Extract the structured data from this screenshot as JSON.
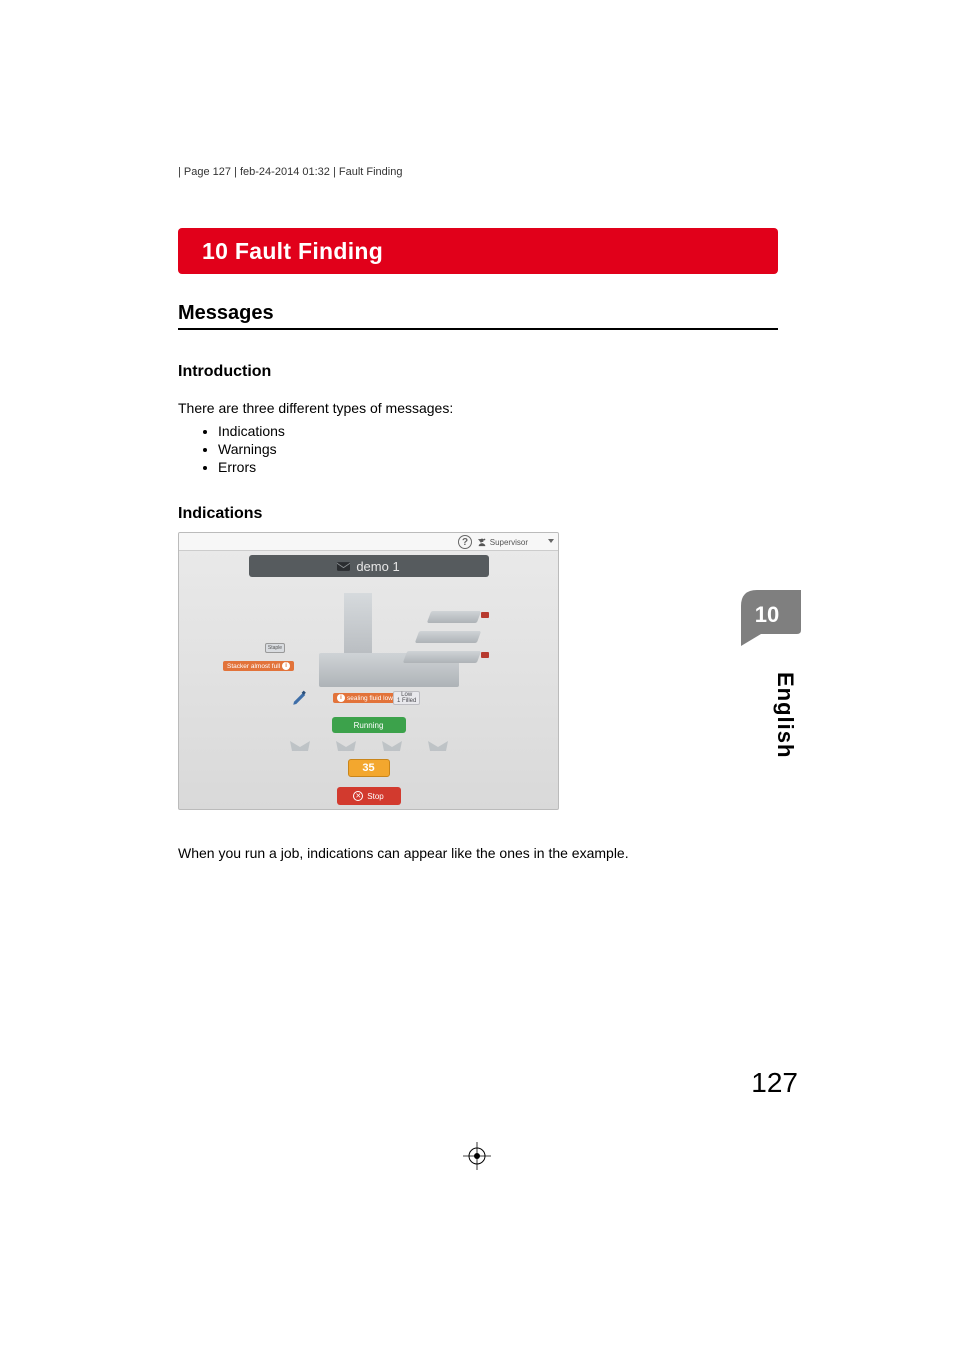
{
  "meta": {
    "line": "| Page 127 | feb-24-2014 01:32 | Fault Finding"
  },
  "chapter": {
    "title": "10 Fault Finding"
  },
  "sections": {
    "messages_heading": "Messages",
    "introduction_heading": "Introduction",
    "intro_text": "There are three different types of messages:",
    "bullets": [
      "Indications",
      "Warnings",
      "Errors"
    ],
    "indications_heading": "Indications",
    "caption": "When you run a job, indications can appear like the ones in the example."
  },
  "screenshot": {
    "user_role": "Supervisor",
    "job_name": "demo 1",
    "tag_stacker": "Stacker almost full",
    "tag_sealing": "sealing fluid low",
    "staple_label": "Staple",
    "sealing_fluid_line1": "Low",
    "sealing_fluid_line2": "1 Filled",
    "running_label": "Running",
    "count": "35",
    "stop_label": "Stop"
  },
  "side": {
    "chapter_number": "10",
    "language": "English"
  },
  "page_number": "127"
}
